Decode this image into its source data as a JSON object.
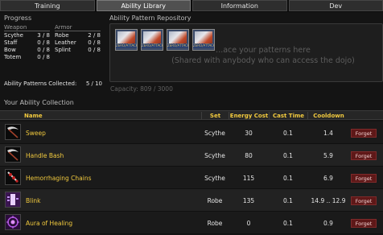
{
  "tabs": [
    {
      "label": "Training"
    },
    {
      "label": "Ability Library"
    },
    {
      "label": "Information"
    },
    {
      "label": "Dev"
    }
  ],
  "progress": {
    "title": "Progress",
    "weapon_header": "Weapon",
    "armor_header": "Armor",
    "weapons": [
      {
        "name": "Scythe",
        "value": "3 / 8"
      },
      {
        "name": "Staff",
        "value": "0 / 8"
      },
      {
        "name": "Bow",
        "value": "0 / 8"
      },
      {
        "name": "Totem",
        "value": "0 / 8"
      }
    ],
    "armors": [
      {
        "name": "Robe",
        "value": "2 / 8"
      },
      {
        "name": "Leather",
        "value": "0 / 8"
      },
      {
        "name": "Splint",
        "value": "0 / 8"
      }
    ],
    "collected_label": "Ability Patterns Collected:",
    "collected_value": "5 / 10"
  },
  "repository": {
    "title": "Ability Pattern Repository",
    "hint_line1": "...ace your patterns here",
    "hint_line2": "(Shared with anybody who can access the dojo)",
    "capacity": "Capacity: 809 / 3000",
    "card_band": "ZERO/ATTACK"
  },
  "collection": {
    "title": "Your Ability Collection",
    "headers": [
      "Name",
      "Set",
      "Energy Cost",
      "Cast Time",
      "Cooldown"
    ],
    "rows": [
      {
        "icon": "scythe-icon",
        "name": "Sweep",
        "set": "Scythe",
        "energy": "30",
        "cast": "0.1",
        "cooldown": "1.4",
        "action": "Forget"
      },
      {
        "icon": "scythe-icon",
        "name": "Handle Bash",
        "set": "Scythe",
        "energy": "80",
        "cast": "0.1",
        "cooldown": "5.9",
        "action": "Forget"
      },
      {
        "icon": "blood-blade-icon",
        "name": "Hemorrhaging Chains",
        "set": "Scythe",
        "energy": "115",
        "cast": "0.1",
        "cooldown": "6.9",
        "action": "Forget"
      },
      {
        "icon": "blink-icon",
        "name": "Blink",
        "set": "Robe",
        "energy": "135",
        "cast": "0.1",
        "cooldown": "14.9 .. 12.9",
        "action": "Forget"
      },
      {
        "icon": "aura-icon",
        "name": "Aura of Healing",
        "set": "Robe",
        "energy": "0",
        "cast": "0.1",
        "cooldown": "0.9",
        "action": "Forget"
      }
    ]
  },
  "colors": {
    "accent": "#f2ca3e",
    "danger": "#5e1818",
    "background": "#141414"
  }
}
